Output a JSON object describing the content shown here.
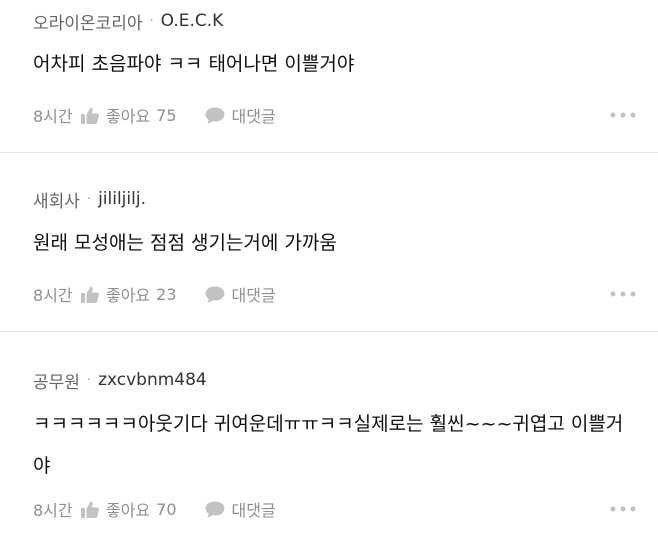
{
  "comments": [
    {
      "company": "오라이온코리아",
      "separator": "·",
      "nickname": "O.E.C.K",
      "text": "어차피 초음파야 ㅋㅋ 태어나면 이쁠거야",
      "time": "8시간",
      "like_label": "좋아요",
      "like_count": "75",
      "reply_label": "대댓글"
    },
    {
      "company": "새회사",
      "separator": "·",
      "nickname": "jililjilj.",
      "text": "원래 모성애는 점점 생기는거에 가까움",
      "time": "8시간",
      "like_label": "좋아요",
      "like_count": "23",
      "reply_label": "대댓글"
    },
    {
      "company": "공무원",
      "separator": "·",
      "nickname": "zxcvbnm484",
      "text": "ㅋㅋㅋㅋㅋㅋ아웃기다 귀여운데ㅠㅠㅋㅋ실제로는 훨씬~~~귀엽고 이쁠거야",
      "time": "8시간",
      "like_label": "좋아요",
      "like_count": "70",
      "reply_label": "대댓글"
    }
  ],
  "icons": {
    "like": "thumbs-up-icon",
    "reply": "speech-bubble-icon",
    "more": "more-dots-icon"
  },
  "colors": {
    "meta_text": "#555555",
    "body_text": "#111111",
    "action_text": "#8f8f8f",
    "icon": "#c2c2c2",
    "divider": "#e4e4e4"
  }
}
